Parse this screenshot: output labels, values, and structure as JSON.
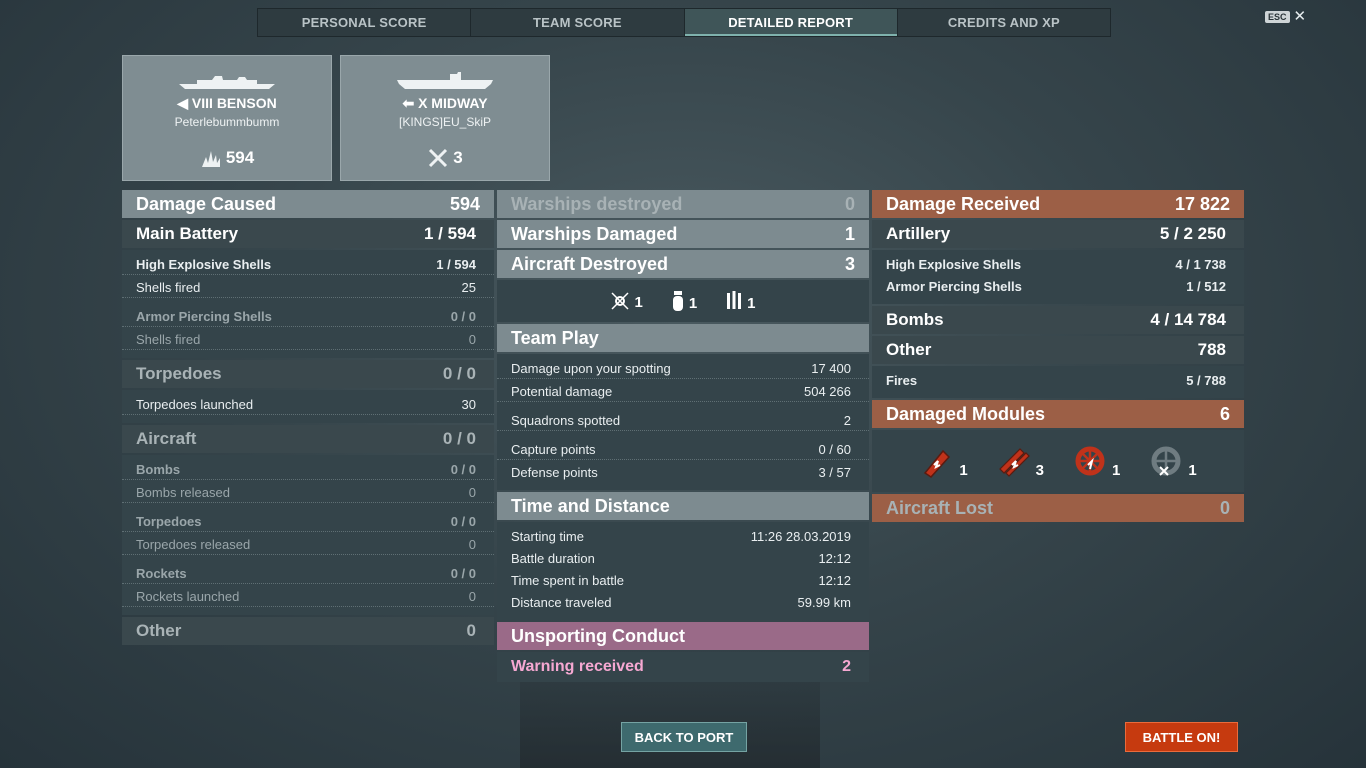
{
  "tabs": [
    "PERSONAL SCORE",
    "TEAM SCORE",
    "DETAILED REPORT",
    "CREDITS AND XP"
  ],
  "esc": {
    "key": "ESC",
    "close": "✕"
  },
  "ships": [
    {
      "name": "VIII BENSON",
      "player": "Peterlebummbumm",
      "stat": "594",
      "icon": "damage-burst-icon",
      "class_icon": "destroyer-class-icon"
    },
    {
      "name": "X MIDWAY",
      "player": "[KINGS]EU_SkiP",
      "stat": "3",
      "icon": "plane-destroyed-icon",
      "class_icon": "carrier-class-icon"
    }
  ],
  "left": {
    "damage_caused": {
      "label": "Damage Caused",
      "value": "594"
    },
    "main_battery": {
      "label": "Main Battery",
      "value": "1 / 594"
    },
    "he_shells": {
      "label": "High Explosive Shells",
      "value": "1 / 594"
    },
    "he_fired": {
      "label": "Shells fired",
      "value": "25"
    },
    "ap_shells": {
      "label": "Armor Piercing Shells",
      "value": "0 / 0"
    },
    "ap_fired": {
      "label": "Shells fired",
      "value": "0"
    },
    "torpedoes": {
      "label": "Torpedoes",
      "value": "0 / 0"
    },
    "torp_launched": {
      "label": "Torpedoes launched",
      "value": "30"
    },
    "aircraft": {
      "label": "Aircraft",
      "value": "0 / 0"
    },
    "bombs": {
      "label": "Bombs",
      "value": "0 / 0"
    },
    "bombs_released": {
      "label": "Bombs released",
      "value": "0"
    },
    "air_torps": {
      "label": "Torpedoes",
      "value": "0 / 0"
    },
    "air_torps_released": {
      "label": "Torpedoes released",
      "value": "0"
    },
    "rockets": {
      "label": "Rockets",
      "value": "0 / 0"
    },
    "rockets_launched": {
      "label": "Rockets launched",
      "value": "0"
    },
    "other": {
      "label": "Other",
      "value": "0"
    }
  },
  "middle": {
    "warships_destroyed": {
      "label": "Warships destroyed",
      "value": "0"
    },
    "warships_damaged": {
      "label": "Warships Damaged",
      "value": "1"
    },
    "aircraft_destroyed": {
      "label": "Aircraft Destroyed",
      "value": "3"
    },
    "aircraft_types": [
      {
        "icon": "fighter-icon",
        "count": "1"
      },
      {
        "icon": "bomber-icon",
        "count": "1"
      },
      {
        "icon": "rocket-plane-icon",
        "count": "1"
      }
    ],
    "team_play": {
      "label": "Team Play"
    },
    "spotting_damage": {
      "label": "Damage upon your spotting",
      "value": "17 400"
    },
    "potential_damage": {
      "label": "Potential damage",
      "value": "504 266"
    },
    "squadrons_spotted": {
      "label": "Squadrons spotted",
      "value": "2"
    },
    "capture_points": {
      "label": "Capture points",
      "value": "0 / 60"
    },
    "defense_points": {
      "label": "Defense points",
      "value": "3 / 57"
    },
    "time_distance": {
      "label": "Time and Distance"
    },
    "starting_time": {
      "label": "Starting time",
      "value": "11:26  28.03.2019"
    },
    "battle_duration": {
      "label": "Battle duration",
      "value": "12:12"
    },
    "time_spent": {
      "label": "Time spent in battle",
      "value": "12:12"
    },
    "distance": {
      "label": "Distance traveled",
      "value": "59.99 km"
    },
    "unsporting": {
      "label": "Unsporting Conduct"
    },
    "warning": {
      "label": "Warning received",
      "value": "2"
    }
  },
  "right": {
    "damage_received": {
      "label": "Damage Received",
      "value": "17 822"
    },
    "artillery": {
      "label": "Artillery",
      "value_a": "5 / ",
      "value_b": "2 250"
    },
    "he_shells": {
      "label": "High Explosive Shells",
      "value_a": "4 / ",
      "value_b": "1 738"
    },
    "ap_shells": {
      "label": "Armor Piercing Shells",
      "value_a": "1 / ",
      "value_b": "512"
    },
    "bombs": {
      "label": "Bombs",
      "value_a": "4 / ",
      "value_b": "14 784"
    },
    "other": {
      "label": "Other",
      "value": "788"
    },
    "fires": {
      "label": "Fires",
      "value_a": "5 / ",
      "value_b": "788"
    },
    "damaged_modules": {
      "label": "Damaged Modules",
      "value": "6"
    },
    "modules": [
      {
        "icon": "main-gun-damaged-icon",
        "count": "1"
      },
      {
        "icon": "torpedo-tubes-damaged-icon",
        "count": "3"
      },
      {
        "icon": "steering-damaged-icon",
        "count": "1"
      },
      {
        "icon": "engine-incapacitated-icon",
        "count": "1"
      }
    ],
    "aircraft_lost": {
      "label": "Aircraft Lost",
      "value": "0"
    }
  },
  "buttons": {
    "back": "BACK TO PORT",
    "battle": "BATTLE ON!"
  },
  "colors": {
    "accent_orange": "#9c5f46",
    "accent_pink": "#9a6a88",
    "battle_button": "#c63a0f",
    "back_button": "#3e6a6e"
  }
}
